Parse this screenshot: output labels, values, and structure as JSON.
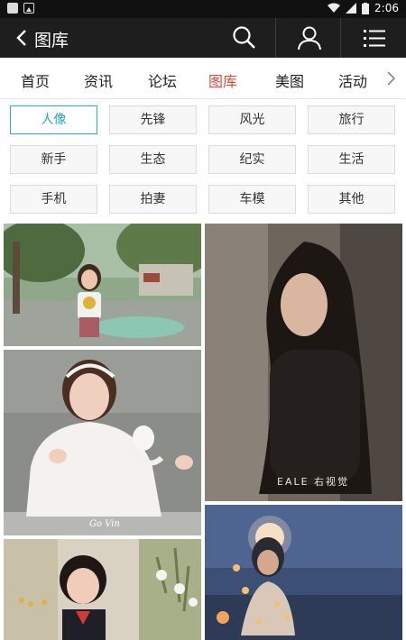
{
  "status": {
    "time": "2:06"
  },
  "header": {
    "title": "图库"
  },
  "tabs": [
    {
      "label": "首页"
    },
    {
      "label": "资讯"
    },
    {
      "label": "论坛"
    },
    {
      "label": "图库",
      "active": true
    },
    {
      "label": "美图"
    },
    {
      "label": "活动"
    }
  ],
  "categories": [
    {
      "label": "人像",
      "active": true
    },
    {
      "label": "先锋"
    },
    {
      "label": "风光"
    },
    {
      "label": "旅行"
    },
    {
      "label": "新手"
    },
    {
      "label": "生态"
    },
    {
      "label": "纪实"
    },
    {
      "label": "生活"
    },
    {
      "label": "手机"
    },
    {
      "label": "拍妻"
    },
    {
      "label": "车模"
    },
    {
      "label": "其他"
    }
  ],
  "photos": [
    {
      "name": "photo-girl-street"
    },
    {
      "name": "photo-woman-dark-hair"
    },
    {
      "name": "photo-girl-white-lace",
      "watermark": "Go Vin"
    },
    {
      "name": "photo-night-lights"
    },
    {
      "name": "photo-girl-flowers"
    }
  ],
  "watermark_brand": "EALE 右视觉",
  "accent": "#e34a3b",
  "category_accent": "#1aa9be"
}
